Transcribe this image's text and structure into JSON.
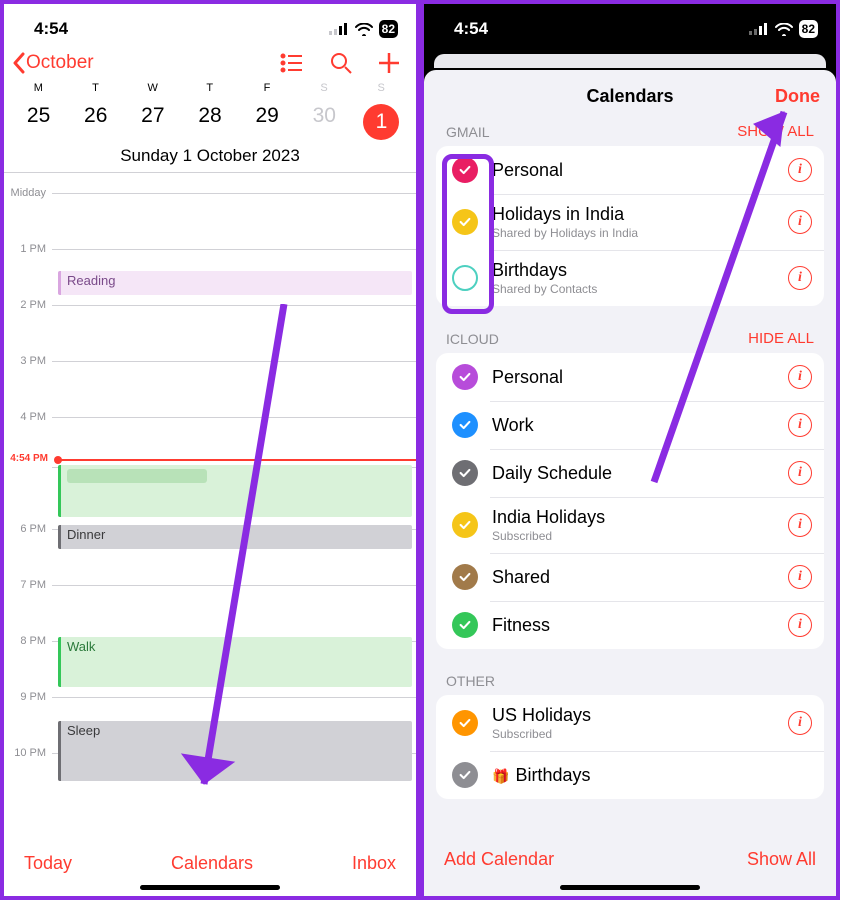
{
  "status": {
    "time": "4:54",
    "battery": "82"
  },
  "phone1": {
    "back_label": "October",
    "days": [
      {
        "wd": "M",
        "num": "25"
      },
      {
        "wd": "T",
        "num": "26"
      },
      {
        "wd": "W",
        "num": "27"
      },
      {
        "wd": "T",
        "num": "28"
      },
      {
        "wd": "F",
        "num": "29"
      },
      {
        "wd": "S",
        "num": "30",
        "dim": true
      },
      {
        "wd": "S",
        "num": "1",
        "selected": true,
        "dim": true
      }
    ],
    "date_title": "Sunday  1 October 2023",
    "midday_label": "Midday",
    "hours": [
      "1 PM",
      "2 PM",
      "3 PM",
      "4 PM",
      "",
      "6 PM",
      "7 PM",
      "8 PM",
      "9 PM",
      "10 PM"
    ],
    "now_label": "4:54 PM",
    "events": {
      "reading": "Reading",
      "dinner": "Dinner",
      "walk": "Walk",
      "sleep": "Sleep"
    },
    "bottom": {
      "today": "Today",
      "calendars": "Calendars",
      "inbox": "Inbox"
    }
  },
  "phone2": {
    "title": "Calendars",
    "done": "Done",
    "sections": {
      "gmail": {
        "header": "GMAIL",
        "action": "SHOW ALL"
      },
      "icloud": {
        "header": "ICLOUD",
        "action": "HIDE ALL"
      },
      "other": {
        "header": "OTHER"
      }
    },
    "gmail_items": [
      {
        "name": "Personal",
        "color": "#e91e63",
        "checked": true
      },
      {
        "name": "Holidays in India",
        "sub": "Shared by Holidays in India",
        "color": "#f5c518",
        "checked": true
      },
      {
        "name": "Birthdays",
        "sub": "Shared by Contacts",
        "color": "#4dd0c0",
        "checked": false
      }
    ],
    "icloud_items": [
      {
        "name": "Personal",
        "color": "#b74cda",
        "checked": true
      },
      {
        "name": "Work",
        "color": "#1e90ff",
        "checked": true
      },
      {
        "name": "Daily Schedule",
        "color": "#6e6e73",
        "checked": true
      },
      {
        "name": "India Holidays",
        "sub": "Subscribed",
        "color": "#f5c518",
        "checked": true
      },
      {
        "name": "Shared",
        "color": "#a17a4a",
        "checked": true
      },
      {
        "name": "Fitness",
        "color": "#34c759",
        "checked": true
      }
    ],
    "other_items": [
      {
        "name": "US Holidays",
        "sub": "Subscribed",
        "color": "#ff9500",
        "checked": true
      },
      {
        "name": "Birthdays",
        "color": "#8e8e93",
        "checked": true,
        "gift": true
      }
    ],
    "bottom": {
      "add": "Add Calendar",
      "showall": "Show All"
    }
  }
}
